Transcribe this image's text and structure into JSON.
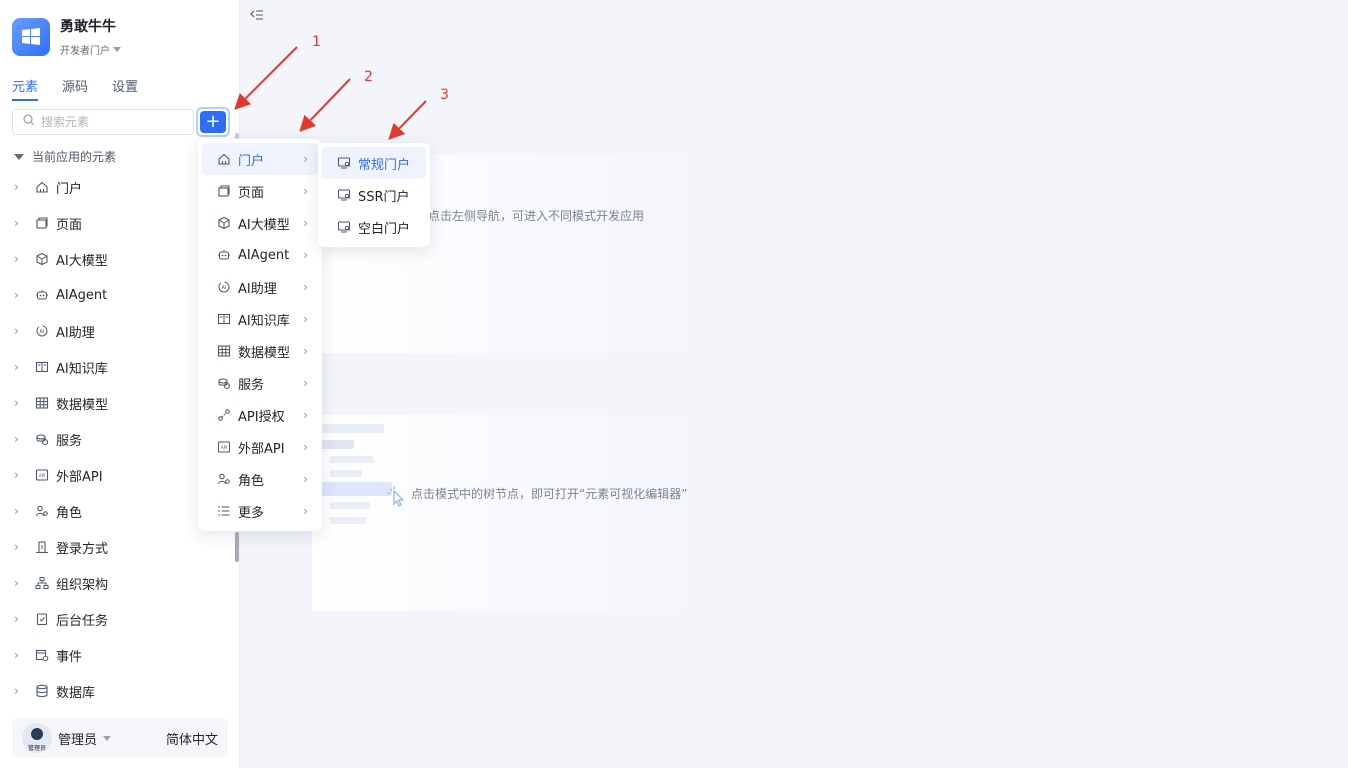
{
  "app": {
    "name": "勇敢牛牛",
    "portal": "开发者门户"
  },
  "tabs": [
    {
      "label": "元素",
      "active": true
    },
    {
      "label": "源码",
      "active": false
    },
    {
      "label": "设置",
      "active": false
    }
  ],
  "search": {
    "placeholder": "搜索元素"
  },
  "add_button": {
    "label": "+"
  },
  "section": {
    "title": "当前应用的元素"
  },
  "tree": [
    {
      "label": "门户",
      "icon": "home-icon"
    },
    {
      "label": "页面",
      "icon": "page-icon"
    },
    {
      "label": "AI大模型",
      "icon": "cube-icon"
    },
    {
      "label": "AIAgent",
      "icon": "robot-icon"
    },
    {
      "label": "AI助理",
      "icon": "ai-assistant-icon"
    },
    {
      "label": "AI知识库",
      "icon": "book-icon"
    },
    {
      "label": "数据模型",
      "icon": "table-icon"
    },
    {
      "label": "服务",
      "icon": "coins-icon"
    },
    {
      "label": "外部API",
      "icon": "api-icon"
    },
    {
      "label": "角色",
      "icon": "role-icon"
    },
    {
      "label": "登录方式",
      "icon": "login-icon"
    },
    {
      "label": "组织架构",
      "icon": "org-icon"
    },
    {
      "label": "后台任务",
      "icon": "task-icon"
    },
    {
      "label": "事件",
      "icon": "event-icon"
    },
    {
      "label": "数据库",
      "icon": "database-icon"
    }
  ],
  "user": {
    "name": "管理员",
    "avatar_tag": "管理员",
    "language": "简体中文"
  },
  "menu": [
    {
      "label": "门户",
      "icon": "home-icon"
    },
    {
      "label": "页面",
      "icon": "page-icon"
    },
    {
      "label": "AI大模型",
      "icon": "cube-icon"
    },
    {
      "label": "AIAgent",
      "icon": "robot-icon"
    },
    {
      "label": "AI助理",
      "icon": "ai-assistant-icon"
    },
    {
      "label": "AI知识库",
      "icon": "book-icon"
    },
    {
      "label": "数据模型",
      "icon": "table-icon"
    },
    {
      "label": "服务",
      "icon": "coins-icon"
    },
    {
      "label": "API授权",
      "icon": "link-icon"
    },
    {
      "label": "外部API",
      "icon": "api-icon"
    },
    {
      "label": "角色",
      "icon": "role-icon"
    },
    {
      "label": "更多",
      "icon": "list-icon"
    }
  ],
  "submenu": [
    {
      "label": "常规门户",
      "icon": "monitor-icon"
    },
    {
      "label": "SSR门户",
      "icon": "monitor-icon"
    },
    {
      "label": "空白门户",
      "icon": "monitor-icon"
    }
  ],
  "hints": {
    "nav": "点击左侧导航，可进入不同模式开发应用",
    "tree": "点击模式中的树节点，即可打开“元素可视化编辑器”"
  },
  "annotations": [
    "1",
    "2",
    "3"
  ],
  "colors": {
    "accent": "#2f6df6",
    "annotation": "#e03a2e"
  }
}
